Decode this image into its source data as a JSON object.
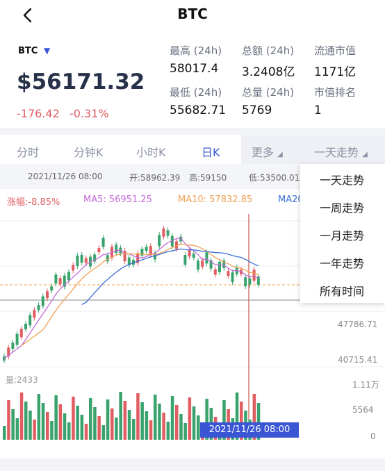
{
  "header": {
    "title": "BTC"
  },
  "summary": {
    "symbol": "BTC",
    "price": "$56171.32",
    "change": "-176.42",
    "change_pct": "-0.31%",
    "stats": [
      {
        "label": "最高 (24h)",
        "value": "58017.4"
      },
      {
        "label": "总额 (24h)",
        "value": "3.2408亿"
      },
      {
        "label": "流通市值",
        "value": "1171亿"
      },
      {
        "label": "最低 (24h)",
        "value": "55682.71"
      },
      {
        "label": "总量 (24h)",
        "value": "5769"
      },
      {
        "label": "市值排名",
        "value": "1"
      }
    ]
  },
  "tabs": [
    {
      "label": "分时"
    },
    {
      "label": "分钟K"
    },
    {
      "label": "小时K"
    },
    {
      "label": "日K",
      "active": true
    },
    {
      "label": "更多"
    },
    {
      "label": "一天走势"
    }
  ],
  "ohlc": {
    "time": "2021/11/26 08:00",
    "open": "开:58962.39",
    "high": "高:59150",
    "low": "低:53500.01"
  },
  "indicators": {
    "amp": "涨幅:-8.85%",
    "ma5": "MA5: 56951.25",
    "ma10": "MA10: 57832.85",
    "ma20": "MA20"
  },
  "axis": {
    "price_mid": "47786.71",
    "price_low": "40715.41",
    "vol_high": "1.11万",
    "vol_mid": "5564",
    "vol_zero": "0"
  },
  "volume_label": "量:2433",
  "crosshair_time": "2021/11/26 08:00",
  "dropdown": [
    "一天走势",
    "一周走势",
    "一月走势",
    "一年走势",
    "所有时间"
  ],
  "colors": {
    "up": "#3aa36d",
    "down": "#e05d62",
    "accent": "#3a56d4",
    "ma5": "#c36ad9",
    "ma10": "#f0a054",
    "ma20": "#3a6fd9"
  }
}
